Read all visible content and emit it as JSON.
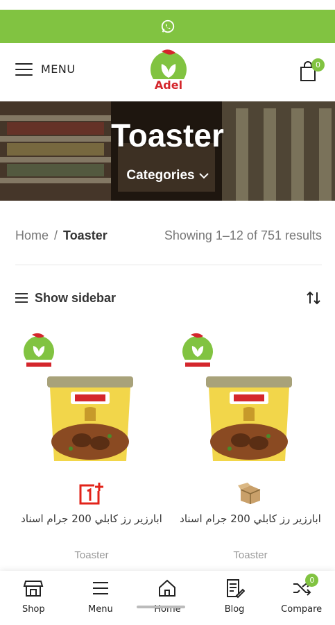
{
  "topbar": {
    "icon": "whatsapp-icon",
    "color": "#81c341"
  },
  "header": {
    "menu_label": "MENU",
    "logo_text": "Adel",
    "cart_count": "0"
  },
  "hero": {
    "title": "Toaster",
    "categories_label": "Categories"
  },
  "breadcrumb": {
    "home": "Home",
    "separator": "/",
    "current": "Toaster"
  },
  "results": "Showing 1–12 of 751 results",
  "toolbar": {
    "show_sidebar": "Show sidebar"
  },
  "products": [
    {
      "title": "ابارزير رز كابلي 200 جرام اسناد",
      "category": "Toaster",
      "brand_icon": "oneplus-logo-icon"
    },
    {
      "title": "ابارزير رز كابلي 200 جرام اسناد",
      "category": "Toaster",
      "brand_icon": "box-icon"
    }
  ],
  "bottom_nav": {
    "shop": "Shop",
    "menu": "Menu",
    "home": "Home",
    "blog": "Blog",
    "compare": "Compare",
    "compare_count": "0"
  },
  "colors": {
    "accent": "#81c341",
    "brand_red": "#d4262c"
  }
}
